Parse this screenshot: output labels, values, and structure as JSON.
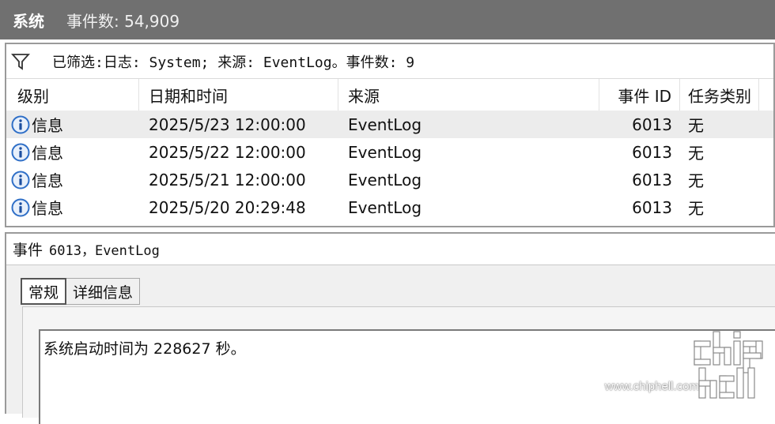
{
  "title_bar": {
    "title": "系统",
    "count_text": "事件数: 54,909"
  },
  "filter": {
    "text": "已筛选:日志: System; 来源: EventLog。事件数: 9"
  },
  "columns": [
    "级别",
    "日期和时间",
    "来源",
    "事件 ID",
    "任务类别"
  ],
  "rows": [
    {
      "level": "信息",
      "datetime": "2025/5/23 12:00:00",
      "source": "EventLog",
      "event_id": "6013",
      "task": "无"
    },
    {
      "level": "信息",
      "datetime": "2025/5/22 12:00:00",
      "source": "EventLog",
      "event_id": "6013",
      "task": "无"
    },
    {
      "level": "信息",
      "datetime": "2025/5/21 12:00:00",
      "source": "EventLog",
      "event_id": "6013",
      "task": "无"
    },
    {
      "level": "信息",
      "datetime": "2025/5/20 20:29:48",
      "source": "EventLog",
      "event_id": "6013",
      "task": "无"
    }
  ],
  "details": {
    "title_prefix": "事件",
    "title_rest": "6013，EventLog",
    "tabs": [
      "常规",
      "详细信息"
    ],
    "description": "系统启动时间为 228627 秒。"
  },
  "watermark": {
    "url": "www.chiphell.com",
    "logo_text": "chip hell"
  },
  "icons": {
    "filter": "funnel-icon",
    "level": "info-icon"
  },
  "colors": {
    "title_bar": "#707070",
    "selected_row": "#ececec",
    "info_icon": "#2f6fc7"
  }
}
